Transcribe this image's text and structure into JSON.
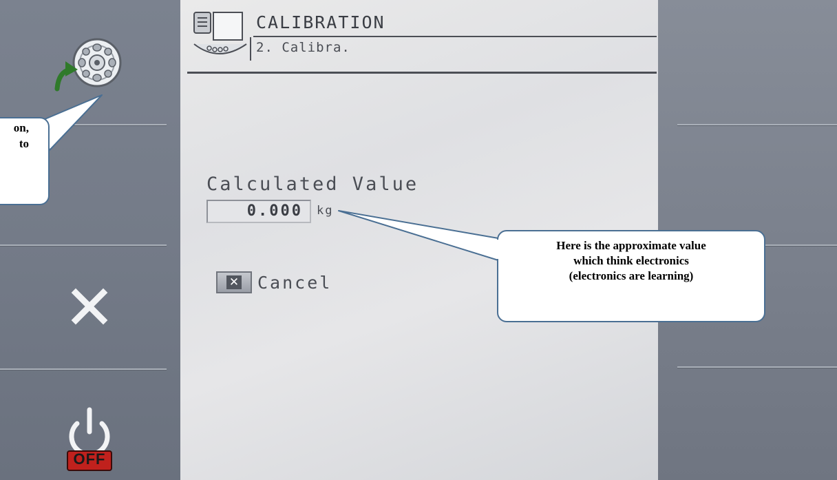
{
  "header": {
    "title": "CALIBRATION",
    "subtitle": "2. Calibra."
  },
  "calculated": {
    "label": "Calculated Value",
    "value": "0.000",
    "unit": "kg"
  },
  "cancel": {
    "label": "Cancel"
  },
  "softkeys": {
    "top_icon": "wheel-with-arrow-icon",
    "middle_icon": "close-x-icon",
    "bottom_icon": "power-off-icon",
    "off_text": "OFF"
  },
  "callouts": {
    "left_line1": "on,",
    "left_line2": "to",
    "right_line1": "Here is the approximate value",
    "right_line2": "which think electronics",
    "right_line3": "(electronics are learning)"
  },
  "colors": {
    "panel": "#747b88",
    "screen": "#e2e3e6",
    "callout_border": "#4a6f93",
    "off_red": "#c0211d",
    "arrow_green": "#2f7a2a"
  }
}
